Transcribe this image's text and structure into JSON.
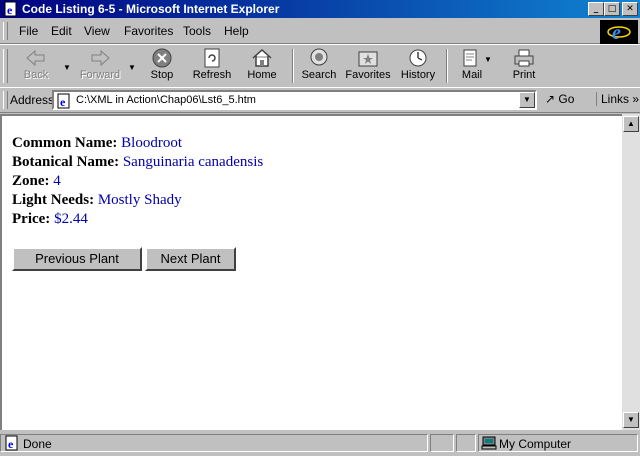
{
  "window": {
    "title": "Code Listing 6-5 - Microsoft Internet Explorer"
  },
  "menu": [
    "File",
    "Edit",
    "View",
    "Favorites",
    "Tools",
    "Help"
  ],
  "toolbar": {
    "back": "Back",
    "forward": "Forward",
    "stop": "Stop",
    "refresh": "Refresh",
    "home": "Home",
    "search": "Search",
    "favorites": "Favorites",
    "history": "History",
    "mail": "Mail",
    "print": "Print"
  },
  "address": {
    "label": "Address",
    "url": "C:\\XML in Action\\Chap06\\Lst6_5.htm",
    "go": "Go",
    "links": "Links"
  },
  "plant": {
    "common_label": "Common Name:",
    "common": "Bloodroot",
    "botanical_label": "Botanical Name:",
    "botanical": "Sanguinaria canadensis",
    "zone_label": "Zone:",
    "zone": "4",
    "light_label": "Light Needs:",
    "light": "Mostly Shady",
    "price_label": "Price:",
    "price": "$2.44"
  },
  "buttons": {
    "previous": "Previous Plant",
    "next": "Next Plant"
  },
  "status": {
    "text": "Done",
    "zone": "My Computer"
  },
  "colors": {
    "title_start": "#000080",
    "title_end": "#1084d0",
    "value_text": "#0000aa",
    "chrome": "#c0c0c0"
  }
}
